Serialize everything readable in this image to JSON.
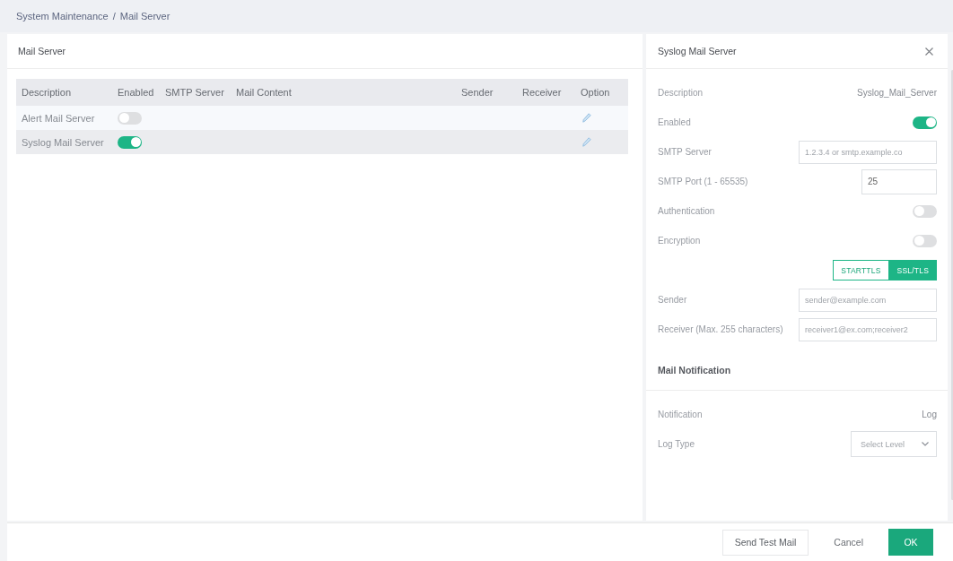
{
  "breadcrumb": {
    "items": [
      "System Maintenance",
      "Mail Server"
    ],
    "separator": "/"
  },
  "list_panel": {
    "title": "Mail Server",
    "table": {
      "columns": [
        "Description",
        "Enabled",
        "SMTP Server",
        "Mail Content",
        "Sender",
        "Receiver",
        "Option"
      ],
      "rows": [
        {
          "description": "Alert Mail Server",
          "enabled": false,
          "selected": false
        },
        {
          "description": "Syslog Mail Server",
          "enabled": true,
          "selected": true
        }
      ]
    }
  },
  "detail_panel": {
    "title": "Syslog Mail Server",
    "fields": [
      {
        "kind": "text",
        "label": "Description",
        "value": "Syslog_Mail_Server"
      },
      {
        "kind": "toggle",
        "label": "Enabled",
        "on": true
      },
      {
        "kind": "input",
        "label": "SMTP Server",
        "placeholder": "1.2.3.4 or smtp.example.co"
      },
      {
        "kind": "number",
        "label": "SMTP Port (1 - 65535)",
        "value": "25"
      },
      {
        "kind": "toggle",
        "label": "Authentication",
        "on": false
      },
      {
        "kind": "toggle",
        "label": "Encryption",
        "on": false
      },
      {
        "kind": "segmented",
        "options": [
          {
            "label": "STARTTLS",
            "selected": false
          },
          {
            "label": "SSL/TLS",
            "selected": true
          }
        ]
      },
      {
        "kind": "input",
        "label": "Sender",
        "placeholder": "sender@example.com"
      },
      {
        "kind": "input",
        "label": "Receiver (Max. 255 characters)",
        "placeholder": "receiver1@ex.com;receiver2"
      }
    ],
    "section": {
      "title": "Mail Notification",
      "fields": [
        {
          "kind": "text",
          "label": "Notification",
          "value": "Log"
        },
        {
          "kind": "select",
          "label": "Log Type",
          "placeholder": "Select Level"
        }
      ]
    }
  },
  "footer": {
    "buttons": [
      {
        "label": "Send Test Mail",
        "kind": "secondary"
      },
      {
        "label": "Cancel",
        "kind": "plain"
      },
      {
        "label": "OK",
        "kind": "primary"
      }
    ]
  }
}
